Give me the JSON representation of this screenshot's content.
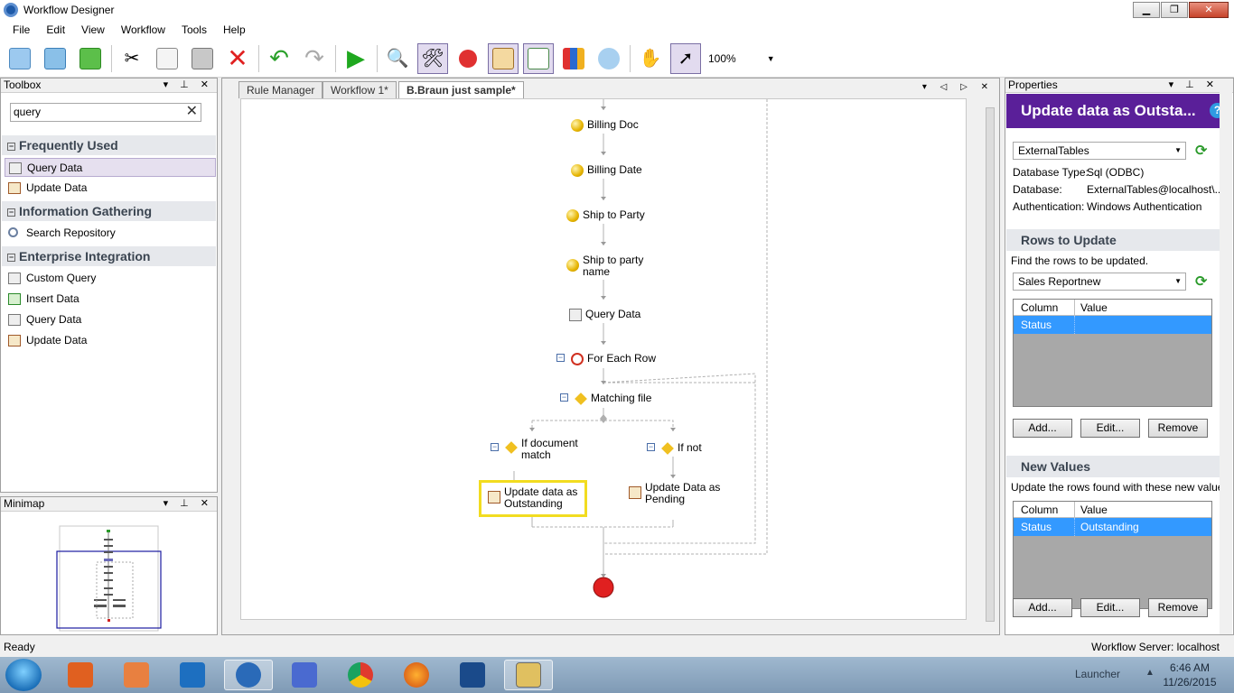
{
  "window": {
    "title": "Workflow Designer"
  },
  "menu": [
    "File",
    "Edit",
    "View",
    "Workflow",
    "Tools",
    "Help"
  ],
  "toolbar": {
    "zoom": "100%"
  },
  "toolbox": {
    "title": "Toolbox",
    "search_value": "query",
    "categories": [
      {
        "name": "Frequently Used",
        "items": [
          "Query Data",
          "Update Data"
        ]
      },
      {
        "name": "Information Gathering",
        "items": [
          "Search Repository"
        ]
      },
      {
        "name": "Enterprise Integration",
        "items": [
          "Custom Query",
          "Insert Data",
          "Query Data",
          "Update Data"
        ]
      }
    ]
  },
  "minimap": {
    "title": "Minimap"
  },
  "designer": {
    "tabs": [
      "Rule Manager",
      "Workflow 1*",
      "B.Braun just sample*"
    ],
    "activities": {
      "billing_doc": "Billing Doc",
      "billing_date": "Billing Date",
      "ship_to_party": "Ship to Party",
      "ship_to_party_name_1": "Ship to party",
      "ship_to_party_name_2": "name",
      "query_data": "Query Data",
      "for_each_row": "For Each Row",
      "matching_file": "Matching file",
      "if_document_match_1": "If document",
      "if_document_match_2": "match",
      "if_not": "If not",
      "update_outstanding_1": "Update data as",
      "update_outstanding_2": "Outstanding",
      "update_pending_1": "Update Data as",
      "update_pending_2": "Pending"
    }
  },
  "properties": {
    "title": "Properties",
    "header": "Update data as Outsta...",
    "table_source": "ExternalTables",
    "db_type_label": "Database Type:",
    "db_type_value": "Sql (ODBC)",
    "db_label": "Database:",
    "db_value": "ExternalTables@localhost\\...",
    "auth_label": "Authentication:",
    "auth_value": "Windows Authentication",
    "rows_section": "Rows to Update",
    "rows_desc": "Find the rows to be updated.",
    "rows_table": "Sales Reportnew",
    "rows_grid": {
      "col1": "Column",
      "col2": "Value",
      "row_column": "Status",
      "row_value": ""
    },
    "new_values_section": "New Values",
    "new_values_desc": "Update the rows found with these new values:",
    "values_grid": {
      "col1": "Column",
      "col2": "Value",
      "row_column": "Status",
      "row_value": "Outstanding"
    },
    "add": "Add...",
    "edit": "Edit...",
    "remove": "Remove"
  },
  "status": {
    "left": "Ready",
    "right": "Workflow Server: localhost"
  },
  "taskbar": {
    "launcher": "Launcher",
    "time": "6:46 AM",
    "date": "11/26/2015"
  }
}
